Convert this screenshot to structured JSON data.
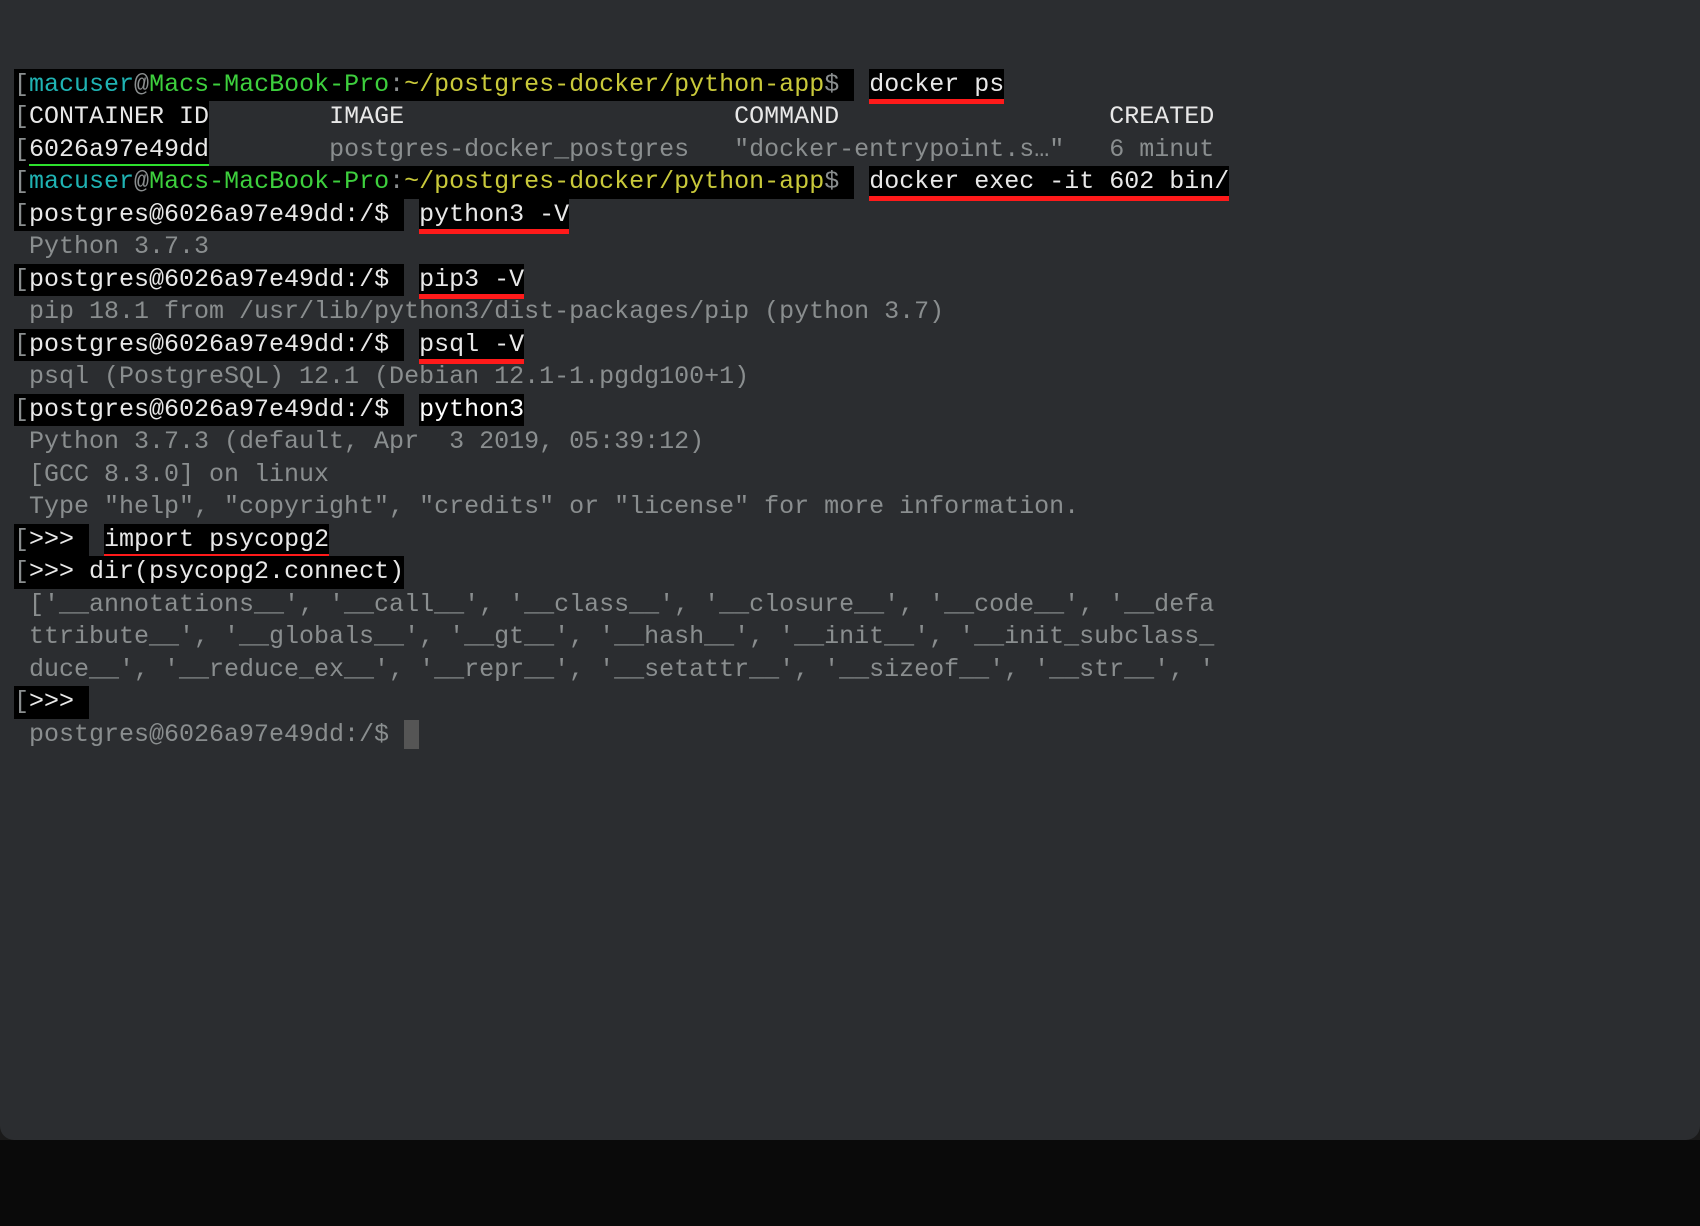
{
  "prompt_host": {
    "bracket_open": "[",
    "user": "macuser",
    "at": "@",
    "host": "Macs-MacBook-Pro",
    "colon": ":",
    "path": "~/postgres-docker/python-app",
    "dollar": "$ "
  },
  "docker_prompt": {
    "bracket_open": "[",
    "text": "postgres@6026a97e49dd:/$ "
  },
  "commands": {
    "docker_ps": "docker ps",
    "docker_exec": "docker exec -it 602 bin/",
    "python3_v": "python3 -V",
    "pip3_v": "pip3 -V",
    "psql_v": "psql -V",
    "python3": "python3",
    "import_psycopg2": "import psycopg2",
    "dir_connect": "dir(psycopg2.connect)"
  },
  "output": {
    "headers": {
      "bracket_open": "[",
      "container_id": "CONTAINER ID",
      "spacing1": "        ",
      "image": "IMAGE",
      "spacing2": "                      ",
      "command": "COMMAND",
      "spacing3": "                  ",
      "created": "CREATED"
    },
    "row": {
      "bracket_open": "[",
      "container_id": "6026a97e49dd",
      "spacing1": "        ",
      "image": "postgres-docker_postgres",
      "spacing2": "   ",
      "command": "\"docker-entrypoint.s…\"",
      "spacing3": "   ",
      "created": "6 minut"
    },
    "python_version": " Python 3.7.3",
    "pip_version": " pip 18.1 from /usr/lib/python3/dist-packages/pip (python 3.7)",
    "psql_version": " psql (PostgreSQL) 12.1 (Debian 12.1-1.pgdg100+1)",
    "python_banner1": " Python 3.7.3 (default, Apr  3 2019, 05:39:12)",
    "python_banner2": " [GCC 8.3.0] on linux",
    "python_banner3": " Type \"help\", \"copyright\", \"credits\" or \"license\" for more information.",
    "dir_result1": " ['__annotations__', '__call__', '__class__', '__closure__', '__code__', '__defa",
    "dir_result2": " ttribute__', '__globals__', '__gt__', '__hash__', '__init__', '__init_subclass_",
    "dir_result3": " duce__', '__reduce_ex__', '__repr__', '__setattr__', '__sizeof__', '__str__', '"
  },
  "repl": {
    "bracket_open": "[",
    "prompt": ">>> "
  },
  "final_prompt": " postgres@6026a97e49dd:/$ ",
  "cursor": " "
}
